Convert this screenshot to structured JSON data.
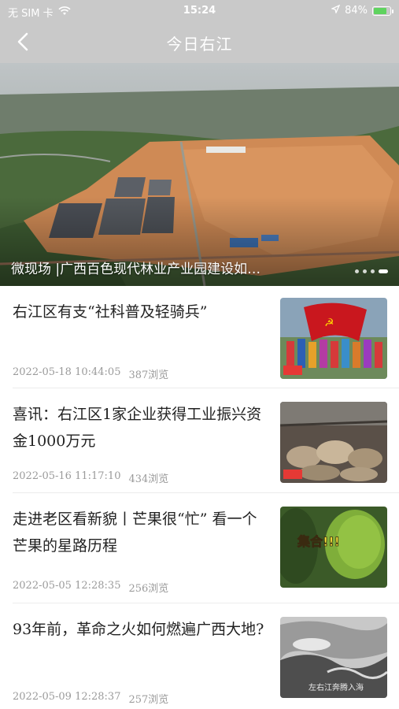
{
  "status_bar": {
    "carrier": "无 SIM 卡",
    "time": "15:24",
    "battery": "84%",
    "battery_level": 0.84
  },
  "nav": {
    "title": "今日右江",
    "back_icon": "chevron-left-icon"
  },
  "banner": {
    "caption": "微现场 |广西百色现代林业产业园建设如…",
    "slide_count": 4,
    "active_slide": 4
  },
  "articles": [
    {
      "title": "右江区有支“社科普及轻骑兵”",
      "date": "2022-05-18 10:44:05",
      "views": "387浏览"
    },
    {
      "title": "喜讯：右江区1家企业获得工业振兴资金1000万元",
      "date": "2022-05-16 11:17:10",
      "views": "434浏览"
    },
    {
      "title": "走进老区看新貌丨芒果很“忙” 看一个芒果的星路历程",
      "date": "2022-05-05 12:28:35",
      "views": "256浏览",
      "thumb_text": "集合!!!"
    },
    {
      "title": "93年前，革命之火如何燃遍广西大地?",
      "date": "2022-05-09 12:28:37",
      "views": "257浏览",
      "thumb_text": "左右江奔腾入海"
    }
  ]
}
